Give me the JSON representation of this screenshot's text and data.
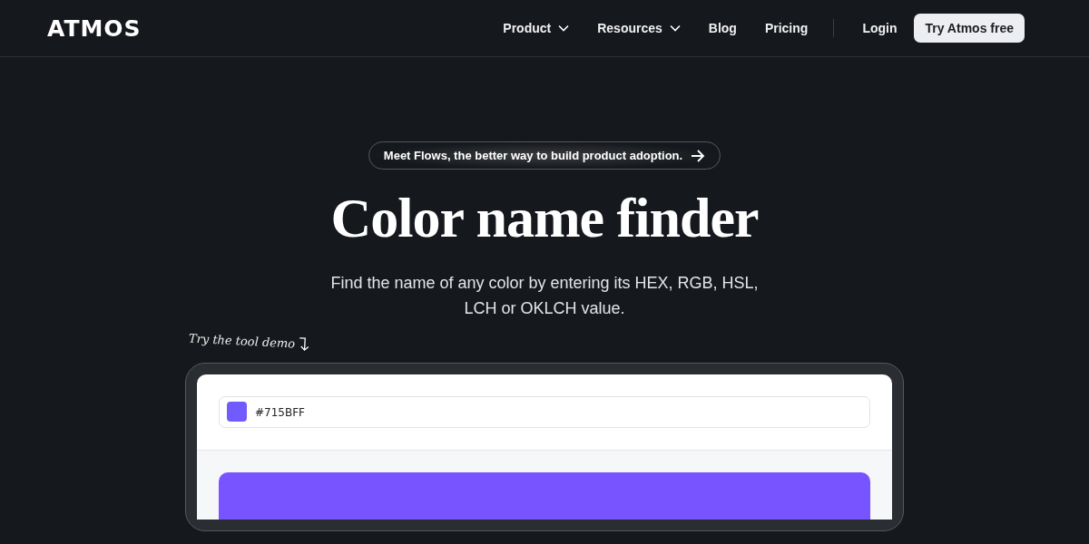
{
  "header": {
    "logo": "ATMOS",
    "nav": [
      {
        "label": "Product",
        "dropdown": true
      },
      {
        "label": "Resources",
        "dropdown": true
      },
      {
        "label": "Blog",
        "dropdown": false
      },
      {
        "label": "Pricing",
        "dropdown": false
      }
    ],
    "login": "Login",
    "cta": "Try Atmos free"
  },
  "announcement": "Meet Flows, the better way to build product adoption.",
  "title": "Color name finder",
  "subtitle": "Find the name of any color by entering its HEX, RGB, HSL, LCH or OKLCH value.",
  "demo_note": "Try the tool demo",
  "demo": {
    "input_value": "#715BFF"
  }
}
